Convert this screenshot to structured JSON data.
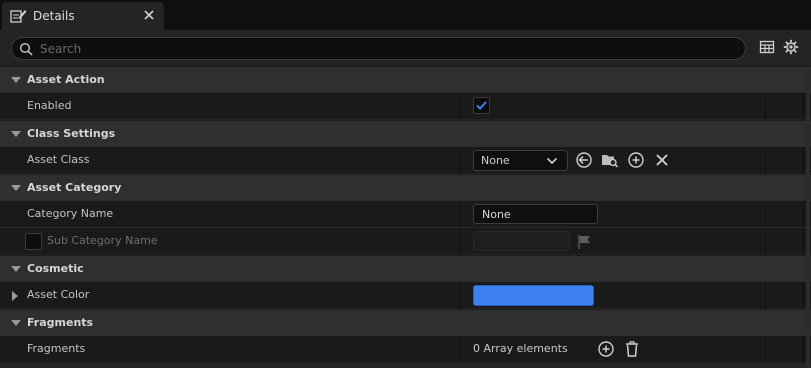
{
  "tab": {
    "title": "Details",
    "icon": "pencil-icon",
    "close_icon": "close-icon"
  },
  "search": {
    "placeholder": "Search"
  },
  "toolbar": {
    "icons": [
      "table-view-icon",
      "settings-gear-icon"
    ]
  },
  "categories": {
    "asset_action": "Asset Action",
    "class_settings": "Class Settings",
    "asset_category": "Asset Category",
    "cosmetic": "Cosmetic",
    "fragments": "Fragments"
  },
  "properties": {
    "enabled": {
      "label": "Enabled",
      "checked": true
    },
    "asset_class": {
      "label": "Asset Class",
      "value": "None",
      "icons": [
        "use-selected-arrow-icon",
        "browse-folder-icon",
        "add-icon",
        "clear-icon"
      ]
    },
    "category_name": {
      "label": "Category Name",
      "value": "None"
    },
    "sub_category_name": {
      "label": "Sub Category Name",
      "enabled": false,
      "value": "",
      "icon": "flag-icon"
    },
    "asset_color": {
      "label": "Asset Color",
      "color": "#3d80f2"
    },
    "fragments": {
      "label": "Fragments",
      "value": "0 Array elements",
      "icons": [
        "add-element-icon",
        "delete-icon"
      ]
    }
  },
  "colors": {
    "accent": "#3d80f2",
    "panel": "#242424",
    "row": "#1a1a1a",
    "category": "#2f2f2f"
  }
}
